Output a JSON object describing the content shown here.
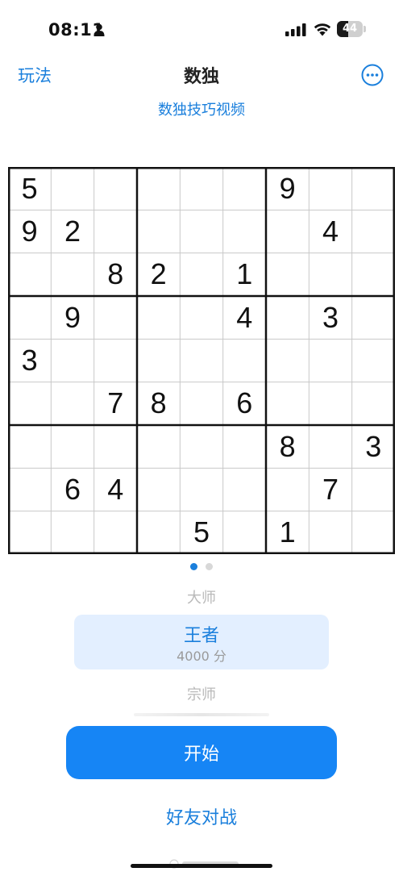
{
  "status_bar": {
    "time": "08:11",
    "battery": "44",
    "battery_percent": 44
  },
  "nav": {
    "left_label": "玩法",
    "title": "数独",
    "subtitle_link": "数独技巧视频",
    "more_icon": "ellipsis-circle-icon"
  },
  "board": {
    "grid": [
      [
        "5",
        "",
        "",
        "",
        "",
        "",
        "9",
        "",
        ""
      ],
      [
        "9",
        "2",
        "",
        "",
        "",
        "",
        "",
        "4",
        ""
      ],
      [
        "",
        "",
        "8",
        "2",
        "",
        "1",
        "",
        "",
        ""
      ],
      [
        "",
        "9",
        "",
        "",
        "",
        "4",
        "",
        "3",
        ""
      ],
      [
        "3",
        "",
        "",
        "",
        "",
        "",
        "",
        "",
        ""
      ],
      [
        "",
        "",
        "7",
        "8",
        "",
        "6",
        "",
        "",
        ""
      ],
      [
        "",
        "",
        "",
        "",
        "",
        "",
        "8",
        "",
        "3"
      ],
      [
        "",
        "6",
        "4",
        "",
        "",
        "",
        "",
        "7",
        ""
      ],
      [
        "",
        "",
        "",
        "",
        "5",
        "",
        "1",
        "",
        ""
      ]
    ]
  },
  "page_indicator": {
    "count": 2,
    "active": 0
  },
  "levels": {
    "previous": "大师",
    "selected": "王者",
    "selected_score": "4000 分",
    "next": "宗师"
  },
  "actions": {
    "start_label": "开始",
    "friend_label": "好友对战"
  },
  "colors": {
    "accent": "#1a7fdc",
    "button": "#1685f5",
    "selected_bg": "#e3efff"
  }
}
